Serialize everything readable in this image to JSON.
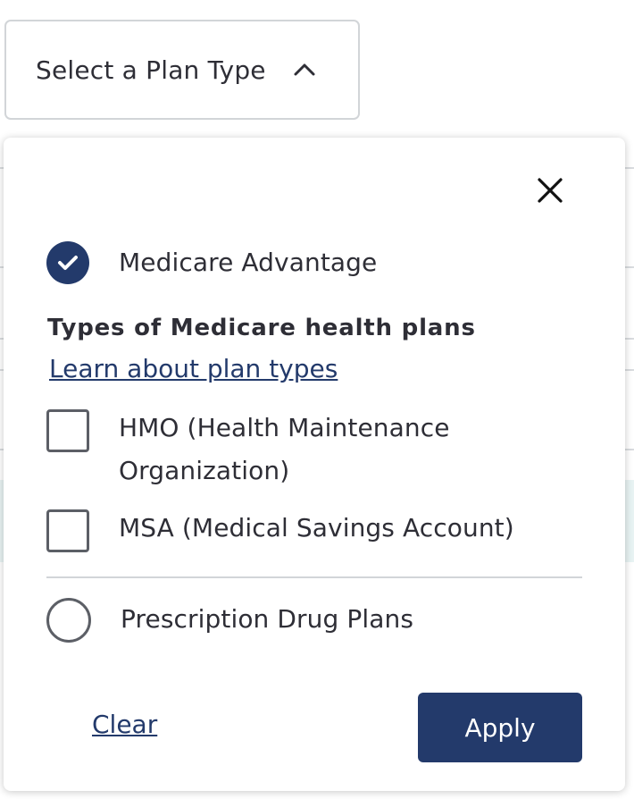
{
  "trigger": {
    "label": "Select a Plan Type",
    "icon": "chevron-up-icon"
  },
  "popover": {
    "close_icon": "close-icon",
    "options": [
      {
        "label": "Medicare Advantage",
        "control": "radio",
        "selected": true
      }
    ],
    "section_heading": "Types of Medicare health plans",
    "learn_link": "Learn about plan types",
    "sub_options": [
      {
        "label": "HMO (Health Maintenance Organization)",
        "control": "checkbox",
        "checked": false
      },
      {
        "label": "MSA (Medical Savings Account)",
        "control": "checkbox",
        "checked": false
      }
    ],
    "drug_option": {
      "label": "Prescription Drug Plans",
      "control": "radio",
      "selected": false
    },
    "clear_label": "Clear",
    "apply_label": "Apply"
  },
  "colors": {
    "primary": "#233a6b",
    "text": "#2e2e36",
    "border": "#d2d5d8"
  }
}
